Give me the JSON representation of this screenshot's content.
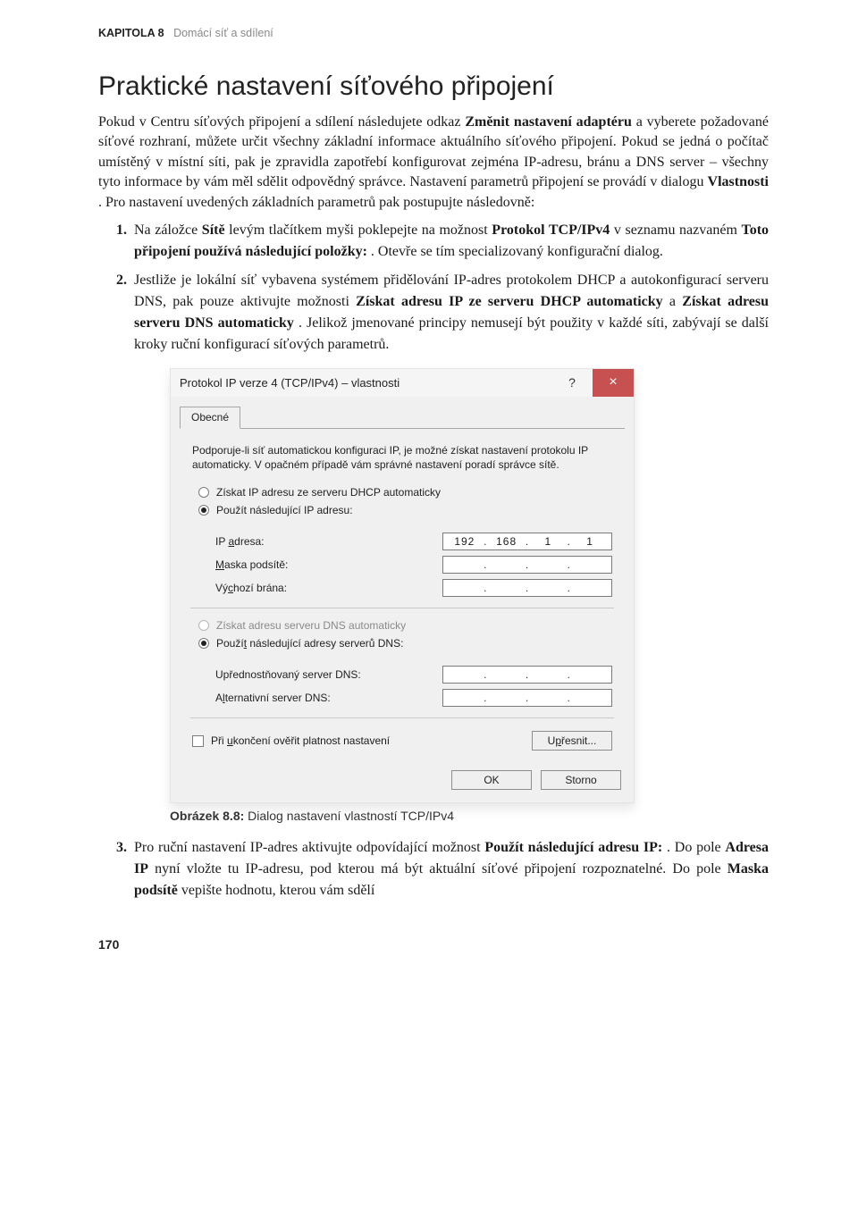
{
  "header": {
    "chapter": "KAPITOLA 8",
    "chapterTitle": "Domácí síť a sdílení"
  },
  "title": "Praktické nastavení síťového připojení",
  "intro_parts": {
    "p1a": "Pokud v Centru síťových připojení a sdílení následujete odkaz ",
    "p1b": "Změnit nastavení adaptéru",
    "p1c": " a vyberete požadované síťové rozhraní, můžete určit všechny základní informace aktuálního síťového připojení. Pokud se jedná o počítač umístěný v místní síti, pak je zpravidla zapotřebí konfigurovat zejména IP-adresu, bránu a DNS server – všechny tyto informace by vám měl sdělit odpovědný správce. Nastavení parametrů připojení se provádí v dialogu ",
    "p1d": "Vlastnosti",
    "p1e": ". Pro nastavení uvedených základních parametrů pak postupujte následovně:"
  },
  "steps": {
    "s1a": "Na záložce ",
    "s1b": "Sítě",
    "s1c": " levým tlačítkem myši poklepejte na možnost ",
    "s1d": "Protokol TCP/IPv4",
    "s1e": " v seznamu nazvaném ",
    "s1f": "Toto připojení používá následující položky:",
    "s1g": ". Otevře se tím specializovaný konfigurační dialog.",
    "s2a": "Jestliže je lokální síť vybavena systémem přidělování IP-adres protokolem DHCP a autokonfigurací serveru DNS, pak pouze aktivujte možnosti ",
    "s2b": "Získat adresu IP ze serveru DHCP automaticky",
    "s2c": " a ",
    "s2d": "Získat adresu serveru DNS automaticky",
    "s2e": ". Jelikož jmenované principy nemusejí být použity v každé síti, zabývají se další kroky ruční konfigurací síťových parametrů.",
    "s3a": "Pro ruční nastavení IP-adres aktivujte odpovídající možnost ",
    "s3b": "Použít následující adresu IP:",
    "s3c": ". Do pole ",
    "s3d": "Adresa IP",
    "s3e": " nyní vložte tu IP-adresu, pod kterou má být aktuální síťové připojení rozpoznatelné. Do pole ",
    "s3f": "Maska podsítě",
    "s3g": " vepište hodnotu, kterou vám sdělí"
  },
  "dialog": {
    "title": "Protokol IP verze 4 (TCP/IPv4) – vlastnosti",
    "helpGlyph": "?",
    "closeGlyph": "×",
    "tab": "Obecné",
    "intro": "Podporuje-li síť automatickou konfiguraci IP, je možné získat nastavení protokolu IP automaticky. V opačném případě vám správné nastavení poradí správce sítě.",
    "r1": "Získat IP adresu ze serveru DHCP automaticky",
    "r2": "Použít následující IP adresu:",
    "ipLabel": "IP adresa:",
    "maskLabel": "Maska podsítě:",
    "gwLabel": "Výchozí brána:",
    "ip": {
      "a": "192",
      "b": "168",
      "c": "1",
      "d": "1"
    },
    "mask": {
      "a": "",
      "b": "",
      "c": "",
      "d": ""
    },
    "gw": {
      "a": "",
      "b": "",
      "c": "",
      "d": ""
    },
    "r3": "Získat adresu serveru DNS automaticky",
    "r4": "Použít následující adresy serverů DNS:",
    "dns1Label": "Upřednostňovaný server DNS:",
    "dns2Label": "Alternativní server DNS:",
    "dns1": {
      "a": "",
      "b": "",
      "c": "",
      "d": ""
    },
    "dns2": {
      "a": "",
      "b": "",
      "c": "",
      "d": ""
    },
    "validateLabel": "Při ukončení ověřit platnost nastavení",
    "advanced": "Upřesnit...",
    "ok": "OK",
    "cancel": "Storno"
  },
  "caption": {
    "figLabel": "Obrázek 8.8:",
    "figText": " Dialog nastavení vlastností TCP/IPv4"
  },
  "pageNumber": "170"
}
